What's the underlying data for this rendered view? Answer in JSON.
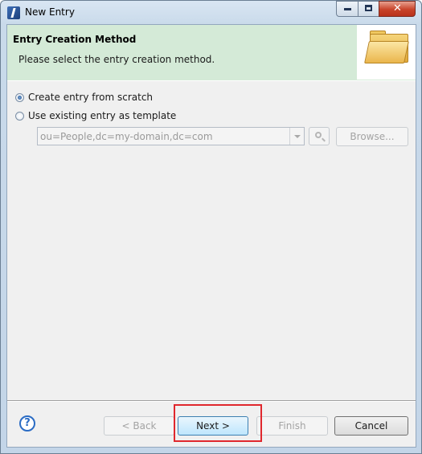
{
  "window": {
    "title": "New Entry"
  },
  "banner": {
    "title": "Entry Creation Method",
    "description": "Please select the entry creation method."
  },
  "options": {
    "scratch_label": "Create entry from scratch",
    "template_label": "Use existing entry as template",
    "selected": "scratch"
  },
  "template": {
    "dn_value": "ou=People,dc=my-domain,dc=com",
    "browse_label": "Browse..."
  },
  "buttons": {
    "help": "?",
    "back": "< Back",
    "next": "Next >",
    "finish": "Finish",
    "cancel": "Cancel"
  },
  "colors": {
    "banner_bg": "#d4ead7",
    "highlight": "#e0272d"
  }
}
